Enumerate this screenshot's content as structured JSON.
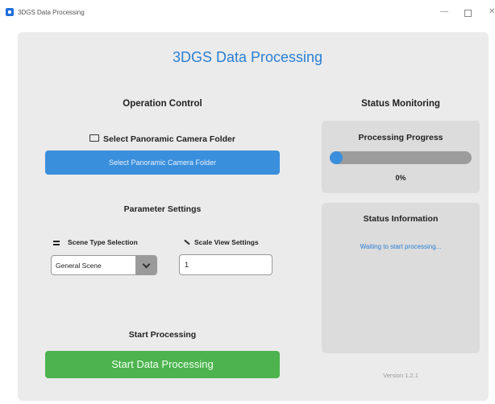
{
  "window": {
    "title": "3DGS Data Processing",
    "minimize_glyph": "—",
    "close_glyph": "✕"
  },
  "app": {
    "title": "3DGS Data Processing",
    "version": "Version 1.2.1"
  },
  "operation": {
    "heading": "Operation Control",
    "folder_heading": "Select Panoramic Camera Folder",
    "folder_button": "Select Panoramic Camera Folder",
    "params_heading": "Parameter Settings",
    "scene_label": "Scene Type Selection",
    "scene_value": "General Scene",
    "scale_label": "Scale View Settings",
    "scale_value": "1",
    "start_heading": "Start Processing",
    "start_button": "Start Data Processing"
  },
  "status": {
    "heading": "Status Monitoring",
    "progress_heading": "Processing Progress",
    "progress_value": 0,
    "progress_text": "0%",
    "info_heading": "Status Information",
    "info_message": "Waiting to start processing..."
  },
  "colors": {
    "accent_blue": "#3a8fdc",
    "title_blue": "#2a7fd4",
    "start_green": "#4db34f"
  },
  "icons": {
    "app": "app-logo-icon",
    "folder": "folder-icon",
    "scene": "scene-type-icon",
    "scale": "pencil-icon",
    "dropdown": "chevron-down-icon"
  }
}
